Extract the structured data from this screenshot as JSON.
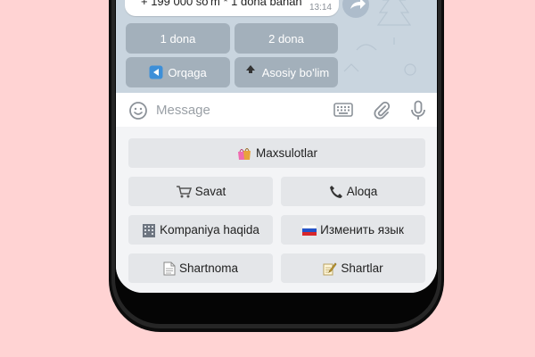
{
  "chat": {
    "message_text": "+ 199 000 so'm * 1 dona bahan",
    "message_time": "13:14",
    "inline_buttons": [
      {
        "label": "1 dona"
      },
      {
        "label": "2 dona"
      },
      {
        "label": "Orqaga",
        "icon": "back-arrow-icon"
      },
      {
        "label": "Asosiy bo'lim",
        "icon": "top-arrow-icon",
        "icon_text": "TOP"
      }
    ]
  },
  "input": {
    "placeholder": "Message"
  },
  "keyboard": {
    "buttons": [
      {
        "label": "Maxsulotlar",
        "icon": "shopping-bags-icon"
      },
      {
        "label": "Savat",
        "icon": "shopping-cart-icon"
      },
      {
        "label": "Aloqa",
        "icon": "phone-icon"
      },
      {
        "label": "Kompaniya haqida",
        "icon": "office-building-icon"
      },
      {
        "label": "Изменить язык",
        "icon": "russia-flag-icon"
      },
      {
        "label": "Shartnoma",
        "icon": "document-icon"
      },
      {
        "label": "Shartlar",
        "icon": "memo-icon"
      }
    ]
  },
  "colors": {
    "background": "#ffd3d3",
    "chat_background": "#c9d5df",
    "inline_button": "#a3b0bb",
    "keyboard_button": "#e4e6e9"
  }
}
